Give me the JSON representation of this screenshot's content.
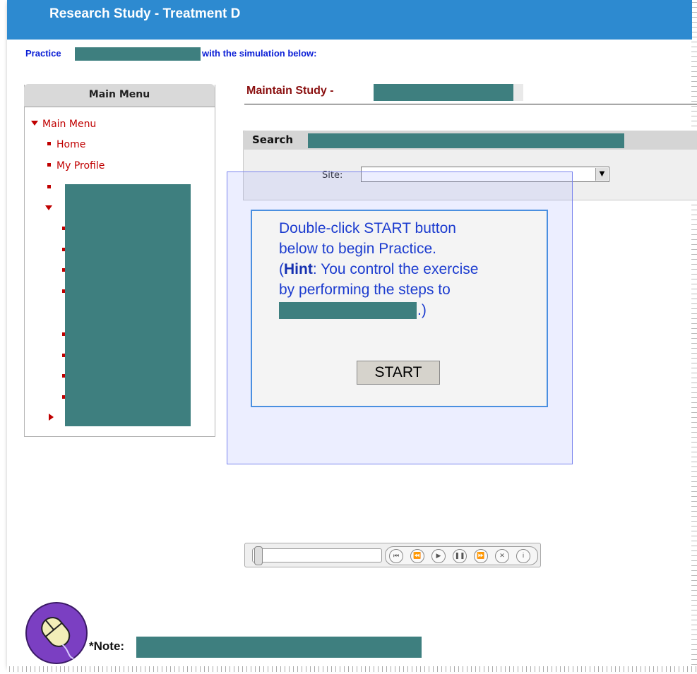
{
  "app": {
    "title": "Research Study - Treatment D"
  },
  "intro": {
    "practice": "Practice",
    "suffix": "with the simulation below:"
  },
  "sidebar": {
    "header": "Main Menu",
    "items": [
      {
        "label": "Main Menu",
        "type": "expanded"
      },
      {
        "label": "Home",
        "type": "bullet"
      },
      {
        "label": "My Profile",
        "type": "bullet"
      }
    ]
  },
  "main": {
    "title": "Maintain Study -",
    "search": {
      "header": "Search",
      "site_label": "Site:",
      "site_value": ""
    }
  },
  "dialog": {
    "line1": "Double-click START button",
    "line2": "below to begin Practice.",
    "hint_open": "(",
    "hint_bold": "Hint",
    "hint_rest": ": You control the exercise",
    "line4": "by performing the steps to",
    "line5_end": ".)",
    "start_label": "START"
  },
  "player": {
    "buttons": [
      "skip-back-icon",
      "rewind-icon",
      "play-icon",
      "pause-icon",
      "fast-forward-icon",
      "close-icon",
      "info-icon"
    ]
  },
  "footer": {
    "note": "*Note:"
  },
  "colors": {
    "titlebar": "#2d8ad0",
    "redaction": "#3e7f7f",
    "menu_red": "#c00000",
    "dialog_text": "#1c3ccf"
  }
}
